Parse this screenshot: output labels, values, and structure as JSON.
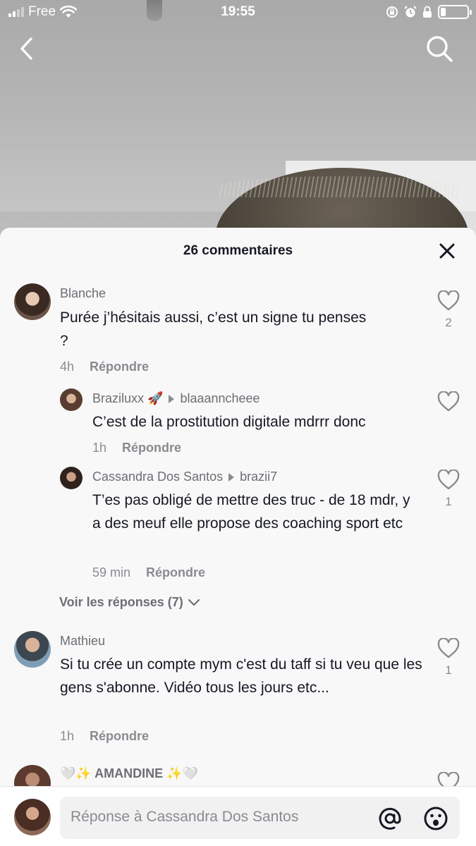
{
  "status_bar": {
    "carrier": "Free",
    "time": "19:55"
  },
  "video": {
    "back_icon": "chevron-left-icon",
    "search_icon": "search-icon"
  },
  "comments_sheet": {
    "title": "26 commentaires",
    "close_icon": "close-icon",
    "comments": [
      {
        "username": "Blanche",
        "text": "Purée j’hésitais aussi, c’est un signe tu penses ?",
        "time": "4h",
        "reply_label": "Répondre",
        "likes": "2",
        "replies": [
          {
            "username": "Braziluxx 🚀",
            "reply_to": "blaaanncheee",
            "text": "C’est de la prostitution digitale mdrrr donc",
            "time": "1h",
            "reply_label": "Répondre",
            "likes": ""
          },
          {
            "username": "Cassandra Dos Santos",
            "reply_to": "brazii7",
            "text": "T’es pas obligé de mettre des truc - de 18 mdr, y a des meuf elle propose des coaching sport etc",
            "time": "59 min",
            "reply_label": "Répondre",
            "likes": "1"
          }
        ],
        "view_replies": "Voir les réponses (7)"
      },
      {
        "username": "Mathieu",
        "text": "Si tu crée un compte mym c'est du taff si tu veu que les gens s'abonne. Vidéo tous les jours etc...",
        "time": "1h",
        "reply_label": "Répondre",
        "likes": "1"
      },
      {
        "username": "🤍✨ AMANDINE ✨🤍",
        "text": "",
        "time": "",
        "reply_label": "",
        "likes": ""
      }
    ]
  },
  "input_bar": {
    "placeholder": "Réponse à Cassandra Dos Santos",
    "mention_icon": "at-icon",
    "emoji_icon": "emoji-icon"
  },
  "colors": {
    "sheet_bg": "#f8f8f8",
    "text_primary": "#161823",
    "text_secondary": "#8a8b91"
  }
}
